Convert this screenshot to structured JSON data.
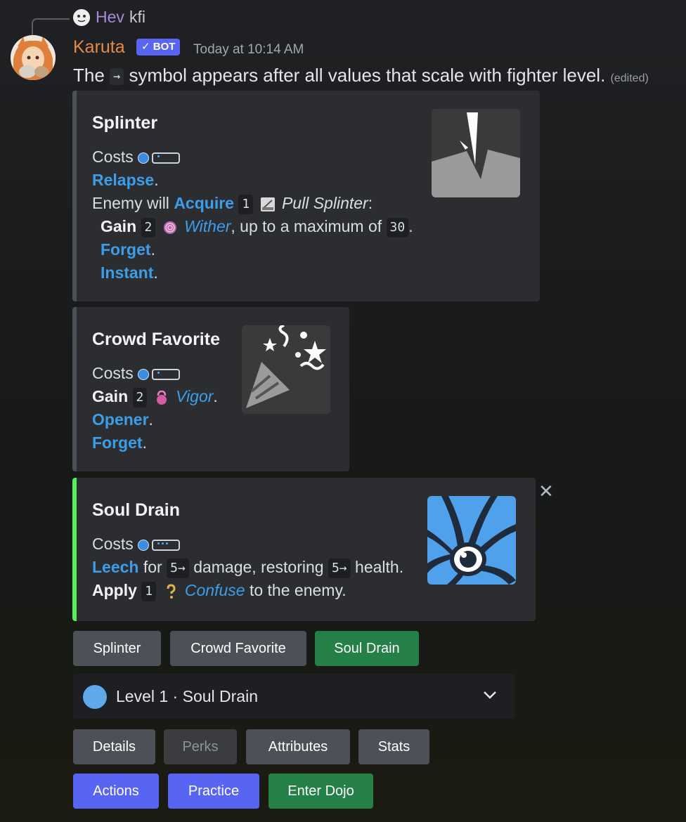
{
  "reply": {
    "author": "Hev",
    "text": "kfi"
  },
  "message": {
    "author": "Karuta",
    "badge": "BOT",
    "badge_check": "✓",
    "timestamp": "Today at 10:14 AM",
    "content_pre": "The",
    "content_arrow": "→",
    "content_post": "symbol appears after all values that scale with fighter level.",
    "edited": "(edited)"
  },
  "embeds": [
    {
      "title": "Splinter",
      "accent": "#4e5058",
      "costs": "Costs",
      "energy_pips": 1,
      "l1_link": "Relapse",
      "l1_end": ".",
      "l2_pre": "Enemy will",
      "l2_link": "Acquire",
      "l2_num": "1",
      "l2_item": "Pull Splinter",
      "l2_end": ":",
      "l3_bold": "Gain",
      "l3_num": "2",
      "l3_link": "Wither",
      "l3_mid": ", up to a maximum of",
      "l3_num2": "30",
      "l3_end": ".",
      "l4_link": "Forget",
      "l4_end": ".",
      "l5_link": "Instant",
      "l5_end": "."
    },
    {
      "title": "Crowd Favorite",
      "accent": "#4e5058",
      "costs": "Costs",
      "energy_pips": 1,
      "l1_bold": "Gain",
      "l1_num": "2",
      "l1_link": "Vigor",
      "l1_end": ".",
      "l2_link": "Opener",
      "l2_end": ".",
      "l3_link": "Forget",
      "l3_end": "."
    },
    {
      "title": "Soul Drain",
      "accent": "#57f05a",
      "costs": "Costs",
      "energy_pips": 3,
      "l1_link": "Leech",
      "l1_mid": "for",
      "l1_num": "5→",
      "l1_mid2": "damage, restoring",
      "l1_num2": "5→",
      "l1_end": "health.",
      "l2_bold": "Apply",
      "l2_num": "1",
      "l2_link": "Confuse",
      "l2_end": "to the enemy."
    }
  ],
  "card_buttons": [
    "Splinter",
    "Crowd Favorite",
    "Soul Drain"
  ],
  "select": {
    "value": "Level 1 · Soul Drain"
  },
  "tab_buttons": [
    "Details",
    "Perks",
    "Attributes",
    "Stats"
  ],
  "action_buttons": [
    "Actions",
    "Practice",
    "Enter Dojo"
  ],
  "colors": {
    "link": "#3c9ee8",
    "blurple": "#5865f2",
    "green": "#248046",
    "grey": "#4e5058"
  }
}
